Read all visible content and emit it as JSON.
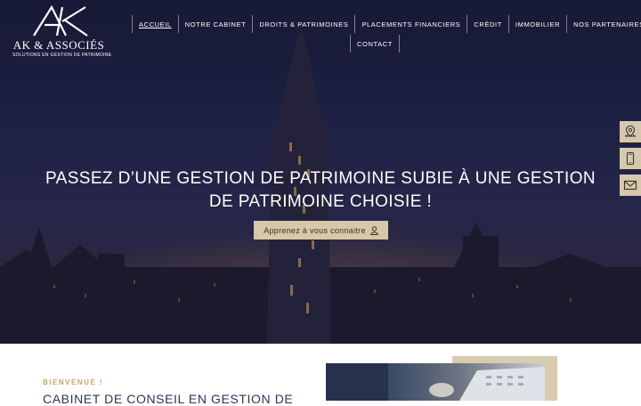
{
  "brand": {
    "name": "AK & ASSOCIÉS",
    "tagline": "SOLUTIONS EN GESTION DE PATRIMOINE"
  },
  "nav": {
    "items": [
      {
        "label": "ACCUEIL",
        "active": true
      },
      {
        "label": "NOTRE CABINET"
      },
      {
        "label": "DROITS & PATRIMOINES"
      },
      {
        "label": "PLACEMENTS FINANCIERS"
      },
      {
        "label": "CRÉDIT"
      },
      {
        "label": "IMMOBILIER"
      },
      {
        "label": "NOS PARTENAIRES"
      },
      {
        "label": "CONTACT"
      }
    ]
  },
  "hero": {
    "headline_line1": "PASSEZ D’UNE GESTION DE PATRIMOINE SUBIE À UNE GESTION",
    "headline_line2": "DE PATRIMOINE CHOISIE !",
    "cta_label": "Apprenez à vous connaitre"
  },
  "side_actions": [
    {
      "icon": "location-pin-icon"
    },
    {
      "icon": "mobile-phone-icon"
    },
    {
      "icon": "envelope-icon"
    }
  ],
  "intro": {
    "kicker": "BIENVENUE !",
    "title": "CABINET DE CONSEIL EN GESTION DE"
  },
  "colors": {
    "accent": "#d6c8a9",
    "kicker": "#c6a56a",
    "title": "#2c3557"
  }
}
